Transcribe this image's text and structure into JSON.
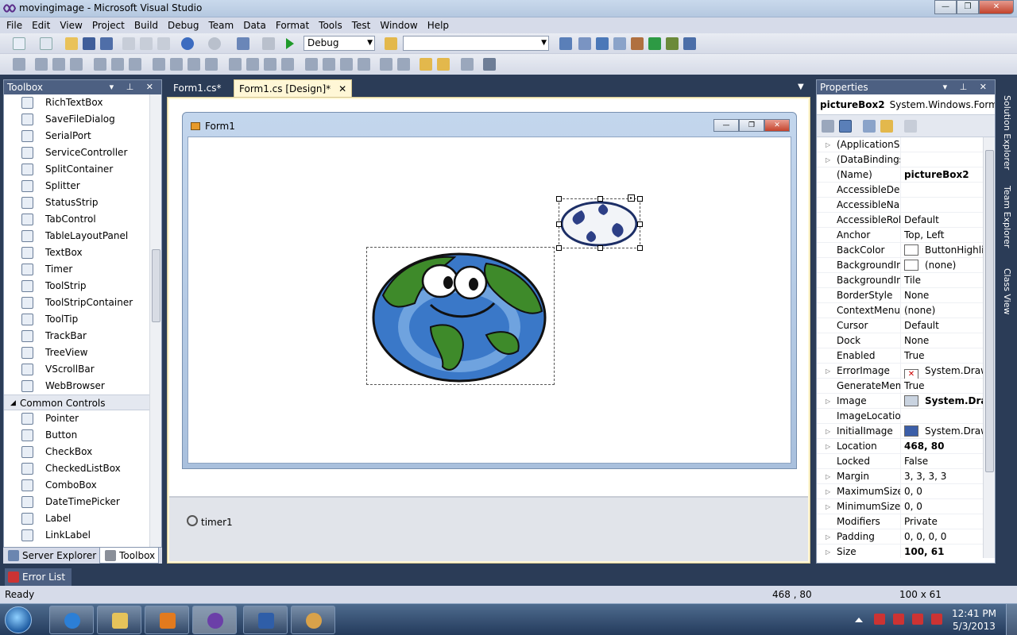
{
  "window": {
    "title": "movingimage - Microsoft Visual Studio"
  },
  "menu": [
    "File",
    "Edit",
    "View",
    "Project",
    "Build",
    "Debug",
    "Team",
    "Data",
    "Format",
    "Tools",
    "Test",
    "Window",
    "Help"
  ],
  "toolbar": {
    "config": "Debug",
    "platform": ""
  },
  "toolbox": {
    "title": "Toolbox",
    "items_top": [
      "RichTextBox",
      "SaveFileDialog",
      "SerialPort",
      "ServiceController",
      "SplitContainer",
      "Splitter",
      "StatusStrip",
      "TabControl",
      "TableLayoutPanel",
      "TextBox",
      "Timer",
      "ToolStrip",
      "ToolStripContainer",
      "ToolTip",
      "TrackBar",
      "TreeView",
      "VScrollBar",
      "WebBrowser"
    ],
    "group": "Common Controls",
    "items_common": [
      "Pointer",
      "Button",
      "CheckBox",
      "CheckedListBox",
      "ComboBox",
      "DateTimePicker",
      "Label",
      "LinkLabel"
    ],
    "bottom_tabs": [
      "Server Explorer",
      "Toolbox"
    ]
  },
  "doctabs": {
    "tab1": "Form1.cs*",
    "tab2": "Form1.cs [Design]*"
  },
  "designer": {
    "form_title": "Form1",
    "tray_component": "timer1"
  },
  "properties": {
    "title": "Properties",
    "object_name": "pictureBox2",
    "object_type": "System.Windows.Forms.",
    "rows": [
      {
        "name": "(ApplicationSet",
        "value": "",
        "exp": true
      },
      {
        "name": "(DataBindings)",
        "value": "",
        "exp": true
      },
      {
        "name": "(Name)",
        "value": "pictureBox2",
        "bold": true
      },
      {
        "name": "AccessibleDesc",
        "value": ""
      },
      {
        "name": "AccessibleNam",
        "value": ""
      },
      {
        "name": "AccessibleRole",
        "value": "Default"
      },
      {
        "name": "Anchor",
        "value": "Top, Left"
      },
      {
        "name": "BackColor",
        "value": "ButtonHighlig",
        "swatch": "#ffffff"
      },
      {
        "name": "BackgroundIma",
        "value": "(none)",
        "swatch": "#ffffff"
      },
      {
        "name": "BackgroundIma",
        "value": "Tile"
      },
      {
        "name": "BorderStyle",
        "value": "None"
      },
      {
        "name": "ContextMenuSt",
        "value": "(none)"
      },
      {
        "name": "Cursor",
        "value": "Default"
      },
      {
        "name": "Dock",
        "value": "None"
      },
      {
        "name": "Enabled",
        "value": "True"
      },
      {
        "name": "ErrorImage",
        "value": "System.Drawi",
        "exp": true,
        "swatch": "#ffffff",
        "redx": true
      },
      {
        "name": "GenerateMemb",
        "value": "True"
      },
      {
        "name": "Image",
        "value": "System.Draw",
        "exp": true,
        "bold": true,
        "swatch": "#c9d3e0"
      },
      {
        "name": "ImageLocation",
        "value": ""
      },
      {
        "name": "InitialImage",
        "value": "System.Drawi",
        "exp": true,
        "swatch": "#3b5ea8"
      },
      {
        "name": "Location",
        "value": "468, 80",
        "exp": true,
        "bold": true
      },
      {
        "name": "Locked",
        "value": "False"
      },
      {
        "name": "Margin",
        "value": "3, 3, 3, 3",
        "exp": true
      },
      {
        "name": "MaximumSize",
        "value": "0, 0",
        "exp": true
      },
      {
        "name": "MinimumSize",
        "value": "0, 0",
        "exp": true
      },
      {
        "name": "Modifiers",
        "value": "Private"
      },
      {
        "name": "Padding",
        "value": "0, 0, 0, 0",
        "exp": true
      },
      {
        "name": "Size",
        "value": "100, 61",
        "exp": true,
        "bold": true
      }
    ]
  },
  "rightdock": [
    "Solution Explorer",
    "Team Explorer",
    "Class View"
  ],
  "errorlist": "Error List",
  "status": {
    "ready": "Ready",
    "location": "468 , 80",
    "size": "100 x 61"
  },
  "taskbar": {
    "time": "12:41 PM",
    "date": "5/3/2013"
  },
  "colors": {
    "panel_header": "#4d6082",
    "designer_bg": "#fff7d6",
    "chrome": "#d6dbe9"
  }
}
